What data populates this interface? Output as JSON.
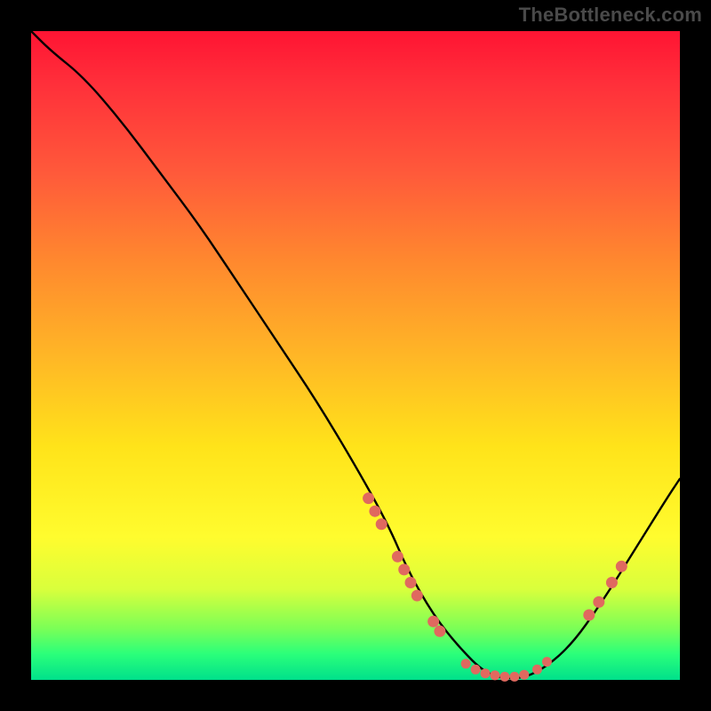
{
  "watermark": "TheBottleneck.com",
  "colors": {
    "dot": "#e0695f",
    "curve": "#000000"
  },
  "chart_data": {
    "type": "line",
    "title": "",
    "xlabel": "",
    "ylabel": "",
    "xlim": [
      0,
      100
    ],
    "ylim": [
      0,
      100
    ],
    "grid": false,
    "legend": false,
    "series": [
      {
        "name": "bottleneck-curve",
        "x": [
          0,
          3,
          8,
          14,
          20,
          26,
          32,
          38,
          44,
          50,
          55,
          58,
          62,
          66,
          70,
          74,
          78,
          83,
          88,
          93,
          98,
          100
        ],
        "y": [
          100,
          97,
          93,
          86,
          78,
          70,
          61,
          52,
          43,
          33,
          24,
          17,
          10,
          5,
          1,
          0,
          1,
          5,
          12,
          20,
          28,
          31
        ]
      }
    ],
    "points": [
      {
        "name": "cluster-left-upper",
        "x": 52,
        "y": 28
      },
      {
        "name": "cluster-left-upper",
        "x": 53,
        "y": 26
      },
      {
        "name": "cluster-left-upper",
        "x": 54,
        "y": 24
      },
      {
        "name": "cluster-left-mid",
        "x": 56.5,
        "y": 19
      },
      {
        "name": "cluster-left-mid",
        "x": 57.5,
        "y": 17
      },
      {
        "name": "cluster-left-mid",
        "x": 58.5,
        "y": 15
      },
      {
        "name": "cluster-left-mid",
        "x": 59.5,
        "y": 13
      },
      {
        "name": "cluster-left-low",
        "x": 62,
        "y": 9
      },
      {
        "name": "cluster-left-low",
        "x": 63,
        "y": 7.5
      },
      {
        "name": "trough",
        "x": 67,
        "y": 2.5
      },
      {
        "name": "trough",
        "x": 68.5,
        "y": 1.6
      },
      {
        "name": "trough",
        "x": 70,
        "y": 1.0
      },
      {
        "name": "trough",
        "x": 71.5,
        "y": 0.7
      },
      {
        "name": "trough",
        "x": 73,
        "y": 0.5
      },
      {
        "name": "trough",
        "x": 74.5,
        "y": 0.5
      },
      {
        "name": "trough",
        "x": 76,
        "y": 0.8
      },
      {
        "name": "trough-right",
        "x": 78,
        "y": 1.6
      },
      {
        "name": "trough-right",
        "x": 79.5,
        "y": 2.8
      },
      {
        "name": "cluster-right",
        "x": 86,
        "y": 10
      },
      {
        "name": "cluster-right",
        "x": 87.5,
        "y": 12
      },
      {
        "name": "cluster-right",
        "x": 89.5,
        "y": 15
      },
      {
        "name": "cluster-right",
        "x": 91,
        "y": 17.5
      }
    ]
  }
}
